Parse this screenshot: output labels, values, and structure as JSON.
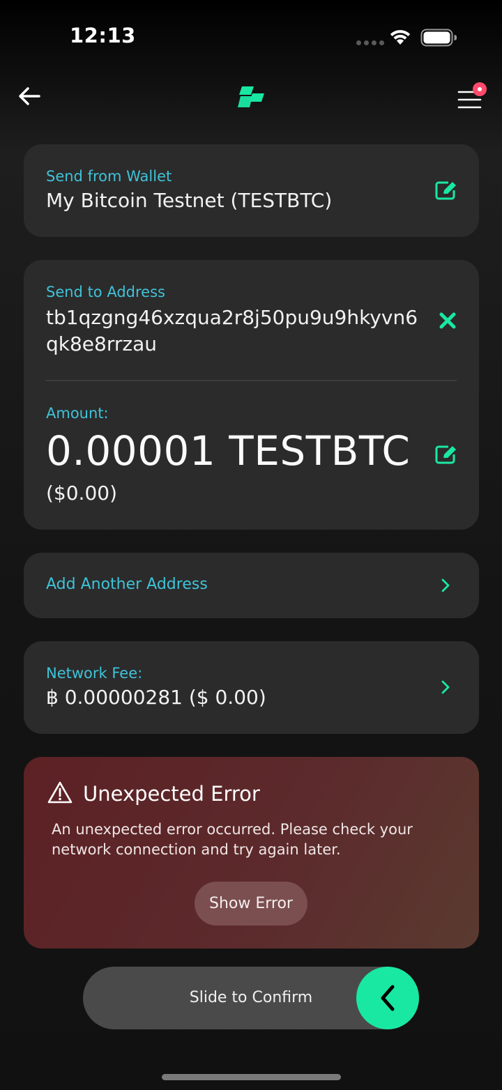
{
  "status_bar": {
    "time": "12:13"
  },
  "colors": {
    "accent": "#19e8a3",
    "label": "#3fc3d8",
    "card": "#2b2b2b",
    "error": "#5c2124",
    "notification_dot": "#ff4a6b"
  },
  "nav": {
    "back_icon": "arrow-left-icon",
    "logo_icon": "app-logo-icon",
    "menu_icon": "hamburger-menu-icon"
  },
  "wallet": {
    "label": "Send from Wallet",
    "value": "My Bitcoin Testnet (TESTBTC)",
    "edit_icon": "edit-icon"
  },
  "address": {
    "label": "Send to Address",
    "value": "tb1qzgng46xzqua2r8j50pu9u9hkyvn6qk8e8rrzau",
    "clear_icon": "close-x-icon"
  },
  "amount": {
    "label": "Amount:",
    "value": "0.00001 TESTBTC",
    "fiat": "($0.00)",
    "edit_icon": "edit-icon"
  },
  "add_address": {
    "label": "Add Another Address",
    "icon": "chevron-right-icon"
  },
  "fee": {
    "label": "Network Fee:",
    "value": "฿ 0.00000281 ($ 0.00)",
    "icon": "chevron-right-icon"
  },
  "error": {
    "icon": "warning-icon",
    "title": "Unexpected Error",
    "message": "An unexpected error occurred. Please check your network connection and try again later.",
    "button": "Show Error"
  },
  "slider": {
    "label": "Slide to Confirm",
    "icon": "chevron-left-icon"
  }
}
